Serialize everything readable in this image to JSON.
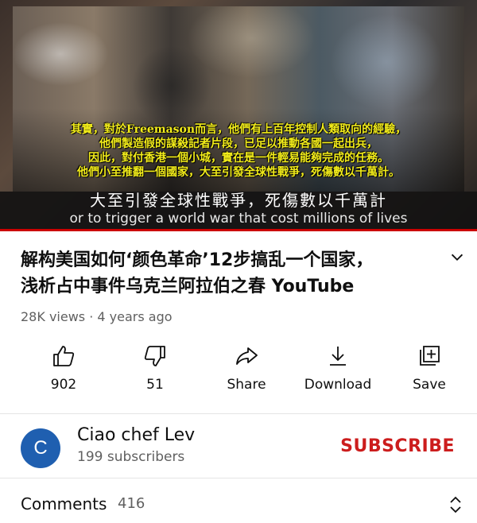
{
  "video": {
    "overlay_lines": [
      "其實，對於Freemason而言，他們有上百年控制人類取向的經驗，",
      "他們製造假的謀殺記者片段，已足以推動各國一起出兵，",
      "因此，對付香港一個小城，實在是一件輕易能夠完成的任務。",
      "他們小至推翻一個國家，大至引發全球性戰爭，死傷數以千萬計。"
    ],
    "subtitle_cn": "大至引發全球性戰爭，死傷數以千萬計",
    "subtitle_en": "or to trigger a world war that cost millions of lives"
  },
  "title_line1": "解构美国如何‘颜色革命’12步搞乱一个国家，",
  "title_line2": "浅析占中事件乌克兰阿拉伯之春   YouTube",
  "meta": "28K views · 4 years ago",
  "actions": {
    "like": "902",
    "dislike": "51",
    "share": "Share",
    "download": "Download",
    "save": "Save"
  },
  "channel": {
    "avatar_letter": "C",
    "name": "Ciao chef Lev",
    "subscribers": "199 subscribers",
    "subscribe_label": "SUBSCRIBE"
  },
  "comments": {
    "label": "Comments",
    "count": "416"
  },
  "colors": {
    "accent_red": "#cc1d1d",
    "avatar_blue": "#1f5fb0",
    "overlay_yellow": "#f2ec1a"
  }
}
